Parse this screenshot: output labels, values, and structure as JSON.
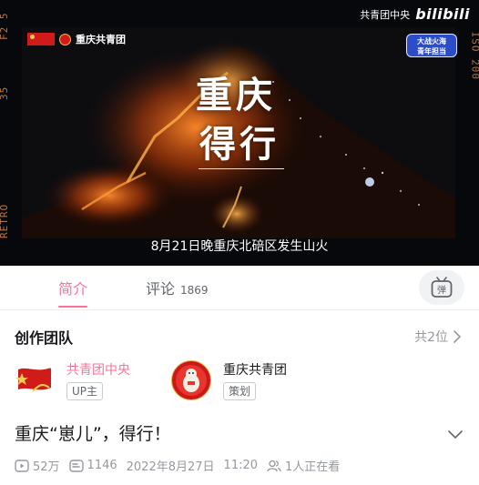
{
  "video": {
    "viewfinder_left_top": "F2 5",
    "viewfinder_left_mid": "35",
    "viewfinder_left_bottom": "RETRO",
    "viewfinder_right": "ISO 200",
    "brand_name": "重庆共青团",
    "up_watermark": "共青团中央",
    "platform_logo": "bilibili",
    "badge_line1": "大战火海",
    "badge_line2": "青年担当",
    "overlay_title_line1": "重庆",
    "overlay_title_line2": "得行",
    "subtitle": "8月21日晚重庆北碚区发生山火"
  },
  "tabs": {
    "intro_label": "简介",
    "comment_label": "评论",
    "comment_count": "1869",
    "danmaku_icon": "danmaku-tv-icon",
    "accent_color": "#fb7299"
  },
  "team": {
    "title": "创作团队",
    "count_label": "共2位",
    "members": [
      {
        "name": "共青团中央",
        "role": "UP主",
        "avatar_icon": "flag-avatar"
      },
      {
        "name": "重庆共青团",
        "role": "策划",
        "avatar_icon": "mascot-avatar"
      }
    ]
  },
  "info": {
    "title": "重庆“崽儿”，得行！",
    "views": "52万",
    "danmaku_count": "1146",
    "date": "2022年8月27日",
    "time": "11:20",
    "watching": "1人正在看"
  }
}
